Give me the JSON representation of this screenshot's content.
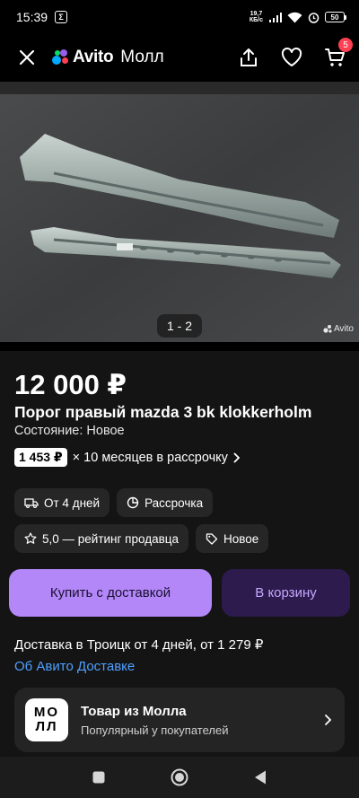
{
  "status_bar": {
    "time": "15:39",
    "sim_label": "Σ",
    "net_speed_value": "19,7",
    "net_speed_unit": "КБ/с",
    "battery": "50"
  },
  "top_bar": {
    "logo_brand": "Avito",
    "logo_sub": "Молл",
    "cart_count": "5",
    "icons": [
      "close-icon",
      "share-icon",
      "heart-icon",
      "cart-icon"
    ]
  },
  "gallery": {
    "counter": "1 - 2",
    "watermark": "Avito"
  },
  "listing": {
    "price": "12 000 ₽",
    "title": "Порог правый mazda 3 bk klokkerholm",
    "condition": "Состояние: Новое",
    "installment_amount": "1 453 ₽",
    "installment_text": "× 10 месяцев в рассрочку"
  },
  "chips": [
    {
      "label": "От 4 дней",
      "icon": "truck-icon"
    },
    {
      "label": "Рассрочка",
      "icon": "pie-icon"
    },
    {
      "label": "5,0 — рейтинг продавца",
      "icon": "star-icon"
    },
    {
      "label": "Новое",
      "icon": "tag-icon"
    }
  ],
  "buttons": {
    "buy": "Купить с доставкой",
    "cart": "В корзину"
  },
  "delivery": {
    "text": "Доставка в Троицк от 4 дней, от 1 279 ₽",
    "link": "Об Авито Доставке"
  },
  "mall_card": {
    "logo_line1": "МО",
    "logo_line2": "ЛЛ",
    "title": "Товар из Молла",
    "subtitle": "Популярный у покупателей"
  },
  "colors": {
    "accent_purple": "#b387f7",
    "cart_btn_bg": "#2c1b4c",
    "link_blue": "#4ea0ff",
    "badge_red": "#ff4053"
  }
}
